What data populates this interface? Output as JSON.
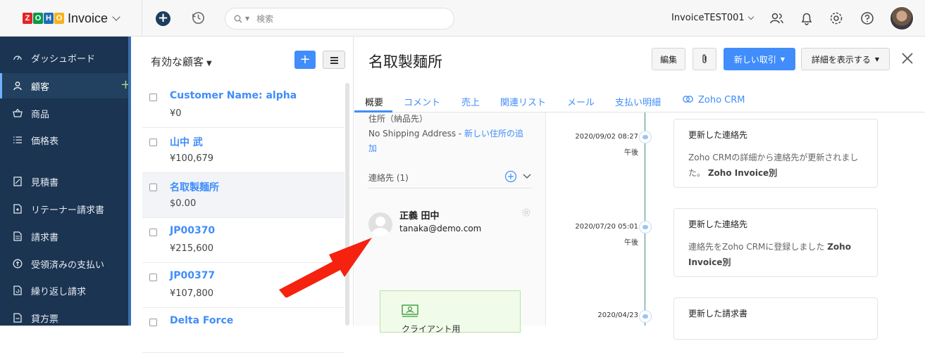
{
  "brand": {
    "logo_letters": [
      "Z",
      "O",
      "H",
      "O"
    ],
    "logo_colors": [
      "#e42527",
      "#089949",
      "#226db4",
      "#f9b21d"
    ],
    "name": "Invoice"
  },
  "topbar": {
    "search_placeholder": "検索",
    "org_name": "InvoiceTEST001"
  },
  "sidebar": {
    "items": [
      {
        "label": "ダッシュボード",
        "icon": "dashboard-icon"
      },
      {
        "label": "顧客",
        "icon": "user-icon",
        "active": true
      },
      {
        "label": "商品",
        "icon": "basket-icon"
      },
      {
        "label": "価格表",
        "icon": "list-icon"
      },
      {
        "label": "見積書",
        "icon": "estimate-icon"
      },
      {
        "label": "リテーナー請求書",
        "icon": "retainer-icon"
      },
      {
        "label": "請求書",
        "icon": "invoice-icon"
      },
      {
        "label": "受領済みの支払い",
        "icon": "payment-icon"
      },
      {
        "label": "繰り返し請求",
        "icon": "recurring-icon"
      },
      {
        "label": "貸方票",
        "icon": "credit-note-icon"
      }
    ]
  },
  "list": {
    "title": "有効な顧客",
    "rows": [
      {
        "name": "Customer Name: alpha",
        "amount": "¥0"
      },
      {
        "name": "山中 武",
        "amount": "¥100,679"
      },
      {
        "name": "名取製麺所",
        "amount": "$0.00",
        "selected": true
      },
      {
        "name": "JP00370",
        "amount": "¥215,600"
      },
      {
        "name": "JP00377",
        "amount": "¥107,800"
      },
      {
        "name": "Delta Force",
        "amount": ""
      }
    ]
  },
  "detail": {
    "title": "名取製麺所",
    "edit_label": "編集",
    "new_transaction_label": "新しい取引",
    "more_label": "詳細を表示する",
    "tabs": [
      "概要",
      "コメント",
      "売上",
      "関連リスト",
      "メール",
      "支払い明細",
      "Zoho CRM"
    ],
    "shipping_heading": "住所（納品先）",
    "no_shipping": "No Shipping Address - ",
    "add_address_1": "新しい住所の追",
    "add_address_2": "加",
    "contacts_heading": "連絡先 (1)",
    "contact_name": "正義 田中",
    "contact_email": "tanaka@demo.com",
    "green_box_text": "クライアント用"
  },
  "timeline": [
    {
      "date": "2020/09/02 08:27",
      "ampm": "午後",
      "title": "更新した連絡先",
      "body": "Zoho CRMの詳細から連絡先が更新されました。",
      "by": "Zoho Invoice別"
    },
    {
      "date": "2020/07/20 05:01",
      "ampm": "午後",
      "title": "更新した連絡先",
      "body": "連絡先をZoho CRMに登録しました",
      "by_1": "Zoho",
      "by_2": "Invoice別"
    },
    {
      "date": "2020/04/23",
      "ampm": "",
      "title": "更新した請求書",
      "body": ""
    }
  ],
  "colors": {
    "accent": "#408dfb",
    "sidebar": "#1b3451",
    "arrow": "#f5220f"
  }
}
